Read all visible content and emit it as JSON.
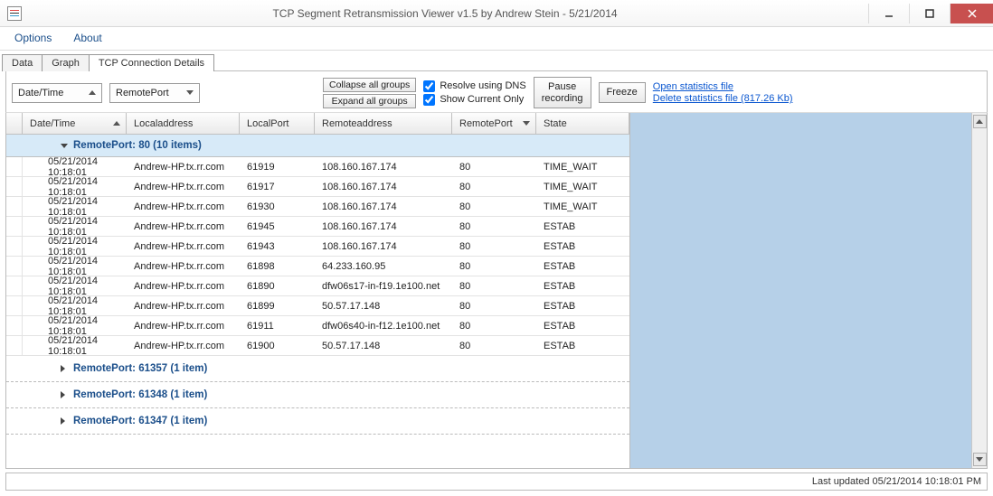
{
  "window": {
    "title": "TCP Segment Retransmission Viewer v1.5 by Andrew Stein - 5/21/2014"
  },
  "menu": {
    "options": "Options",
    "about": "About"
  },
  "tabs": {
    "data": "Data",
    "graph": "Graph",
    "details": "TCP Connection Details"
  },
  "toolbar": {
    "sort1": "Date/Time",
    "sort2": "RemotePort",
    "collapse": "Collapse all groups",
    "expand": "Expand all groups",
    "dns": "Resolve using DNS",
    "current_only": "Show Current Only",
    "pause": "Pause\nrecording",
    "freeze": "Freeze",
    "open_stats": "Open statistics file",
    "delete_stats": "Delete statistics file (817.26 Kb)"
  },
  "columns": {
    "c1": "Date/Time",
    "c2": "Localaddress",
    "c3": "LocalPort",
    "c4": "Remoteaddress",
    "c5": "RemotePort",
    "c6": "State"
  },
  "groups": {
    "g0": {
      "label": "RemotePort: 80 (10 items)"
    },
    "g1": {
      "label": "RemotePort: 61357 (1 item)"
    },
    "g2": {
      "label": "RemotePort: 61348 (1 item)"
    },
    "g3": {
      "label": "RemotePort: 61347 (1 item)"
    }
  },
  "rows": [
    {
      "dt": "05/21/2014 10:18:01",
      "la": "Andrew-HP.tx.rr.com",
      "lp": "61919",
      "ra": "108.160.167.174",
      "rp": "80",
      "st": "TIME_WAIT"
    },
    {
      "dt": "05/21/2014 10:18:01",
      "la": "Andrew-HP.tx.rr.com",
      "lp": "61917",
      "ra": "108.160.167.174",
      "rp": "80",
      "st": "TIME_WAIT"
    },
    {
      "dt": "05/21/2014 10:18:01",
      "la": "Andrew-HP.tx.rr.com",
      "lp": "61930",
      "ra": "108.160.167.174",
      "rp": "80",
      "st": "TIME_WAIT"
    },
    {
      "dt": "05/21/2014 10:18:01",
      "la": "Andrew-HP.tx.rr.com",
      "lp": "61945",
      "ra": "108.160.167.174",
      "rp": "80",
      "st": "ESTAB"
    },
    {
      "dt": "05/21/2014 10:18:01",
      "la": "Andrew-HP.tx.rr.com",
      "lp": "61943",
      "ra": "108.160.167.174",
      "rp": "80",
      "st": "ESTAB"
    },
    {
      "dt": "05/21/2014 10:18:01",
      "la": "Andrew-HP.tx.rr.com",
      "lp": "61898",
      "ra": "64.233.160.95",
      "rp": "80",
      "st": "ESTAB"
    },
    {
      "dt": "05/21/2014 10:18:01",
      "la": "Andrew-HP.tx.rr.com",
      "lp": "61890",
      "ra": "dfw06s17-in-f19.1e100.net",
      "rp": "80",
      "st": "ESTAB"
    },
    {
      "dt": "05/21/2014 10:18:01",
      "la": "Andrew-HP.tx.rr.com",
      "lp": "61899",
      "ra": "50.57.17.148",
      "rp": "80",
      "st": "ESTAB"
    },
    {
      "dt": "05/21/2014 10:18:01",
      "la": "Andrew-HP.tx.rr.com",
      "lp": "61911",
      "ra": "dfw06s40-in-f12.1e100.net",
      "rp": "80",
      "st": "ESTAB"
    },
    {
      "dt": "05/21/2014 10:18:01",
      "la": "Andrew-HP.tx.rr.com",
      "lp": "61900",
      "ra": "50.57.17.148",
      "rp": "80",
      "st": "ESTAB"
    }
  ],
  "status": {
    "text": "Last updated 05/21/2014 10:18:01 PM"
  }
}
